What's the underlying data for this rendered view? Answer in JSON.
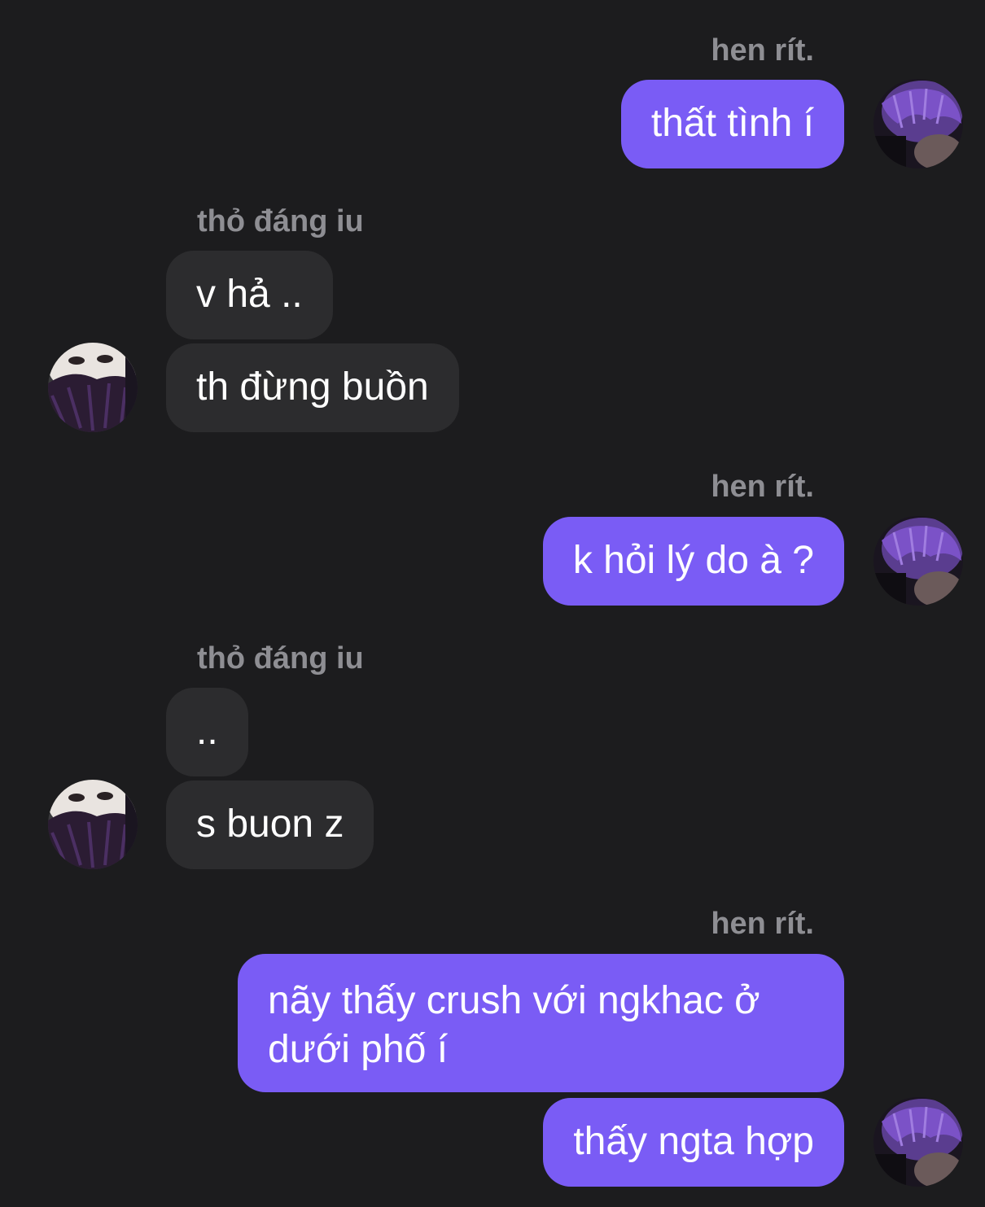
{
  "colors": {
    "background": "#1c1c1e",
    "outgoing_bubble": "#7a5cf5",
    "incoming_bubble": "#2c2c2e",
    "name_text": "#8e8e93"
  },
  "names": {
    "me": "hen rít.",
    "them": "thỏ đáng iu"
  },
  "messages": [
    {
      "text": "thất tình í"
    },
    {
      "text": "v hả .."
    },
    {
      "text": "th đừng buồn"
    },
    {
      "text": "k hỏi lý do à ?"
    },
    {
      "text": ".."
    },
    {
      "text": "s buon z"
    },
    {
      "text": "nãy thấy crush với ngkhac ở dưới phố í"
    },
    {
      "text": "thấy ngta hợp"
    }
  ],
  "avatars": {
    "me": "purple-hair-avatar",
    "them": "face-avatar"
  }
}
